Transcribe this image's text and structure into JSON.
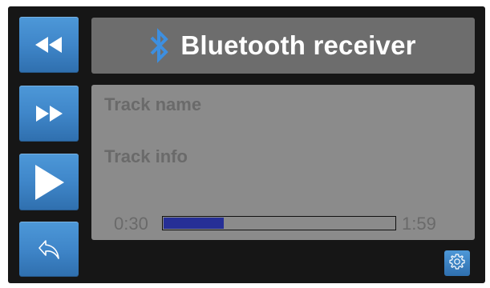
{
  "header": {
    "title": "Bluetooth receiver",
    "icon": "bluetooth-icon"
  },
  "track": {
    "name": "Track name",
    "info": "Track info",
    "elapsed": "0:30",
    "total": "1:59",
    "progress_fraction": 0.26
  },
  "controls": {
    "rewind_icon": "rewind-icon",
    "forward_icon": "fast-forward-icon",
    "play_icon": "play-icon",
    "back_icon": "back-arrow-icon",
    "settings_icon": "gear-icon"
  },
  "colors": {
    "background": "#161616",
    "button_blue": "#3f86c9",
    "header_panel": "#6d6d6d",
    "track_panel": "#8b8b8b",
    "track_text": "#6a6a6a",
    "progress_fill": "#262f96",
    "bluetooth_blue": "#3d8fe0"
  }
}
